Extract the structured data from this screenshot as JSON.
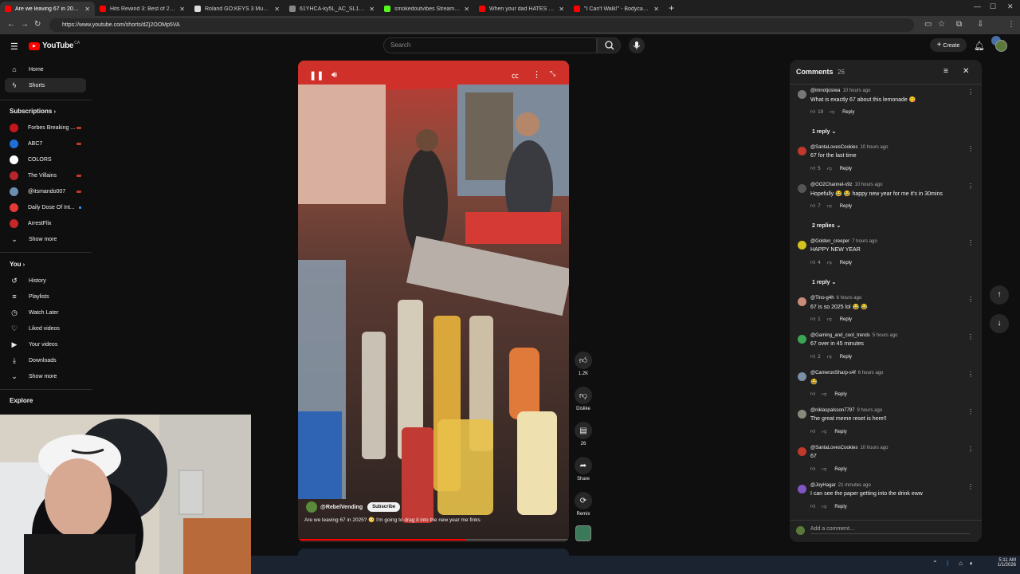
{
  "browser": {
    "tabs": [
      {
        "title": "Are we leaving 67 in 2025?",
        "color": "#ff0000",
        "active": true
      },
      {
        "title": "Hits Rewind 3: Best of 2010's H",
        "color": "#ff0000"
      },
      {
        "title": "Roland GO:KEYS 3 Music Creati",
        "color": "#dddddd"
      },
      {
        "title": "61YHCA-ky5L_AC_SL1500_.jpg",
        "color": "#888888"
      },
      {
        "title": "smokedoutvibes Stream - Watc",
        "color": "#53fc18"
      },
      {
        "title": "When your dad HATES cats",
        "color": "#ff0000"
      },
      {
        "title": "\"I Can't Walk!\" - Bodycam Prov",
        "color": "#ff0000"
      }
    ],
    "new_tab": "+",
    "url": "https://www.youtube.com/shorts/dZj2OOMp5VA"
  },
  "header": {
    "logo": "YouTube",
    "country": "CA",
    "search_placeholder": "Search",
    "create_label": "Create"
  },
  "sidebar": {
    "main": [
      {
        "label": "Home",
        "icon": "home-icon"
      },
      {
        "label": "Shorts",
        "icon": "shorts-icon",
        "active": true
      }
    ],
    "subscriptions_title": "Subscriptions",
    "subscriptions": [
      {
        "label": "Forbes Breaking ...",
        "color": "#c4161c",
        "live": true
      },
      {
        "label": "ABC7",
        "color": "#1e6fd9",
        "live": true
      },
      {
        "label": "COLORS",
        "color": "#ffffff",
        "live": false
      },
      {
        "label": "The Villains",
        "color": "#b8262b",
        "live": true
      },
      {
        "label": "@itsmando007",
        "color": "#6b8fb3",
        "live": true
      },
      {
        "label": "Daily Dose Of Int...",
        "color": "#e53935",
        "live": false,
        "dot": true
      },
      {
        "label": "ArrestFlix",
        "color": "#c62828",
        "live": false
      }
    ],
    "subs_show_more": "Show more",
    "you_title": "You",
    "you_items": [
      {
        "label": "History",
        "icon": "history-icon"
      },
      {
        "label": "Playlists",
        "icon": "playlists-icon"
      },
      {
        "label": "Watch Later",
        "icon": "watch-later-icon"
      },
      {
        "label": "Liked videos",
        "icon": "liked-icon"
      },
      {
        "label": "Your videos",
        "icon": "your-videos-icon"
      },
      {
        "label": "Downloads",
        "icon": "downloads-icon"
      }
    ],
    "you_show_more": "Show more",
    "explore_title": "Explore"
  },
  "short": {
    "channel": "@RebelVending",
    "subscribe_label": "Subscribe",
    "caption": "Are we leaving 67 in 2025? 😳 I'm going to drag it into the new year me finks"
  },
  "actions": {
    "likes": "1.2K",
    "dislike_label": "Dislike",
    "comments_count": "26",
    "share_label": "Share",
    "remix_label": "Remix"
  },
  "comments": {
    "title": "Comments",
    "count": "26",
    "add_placeholder": "Add a comment...",
    "reply_label": "Reply",
    "items": [
      {
        "user": "@imnotjosiwa",
        "ago": "10 hours ago",
        "text": "What is exactly 67 about this lemonade 😋",
        "likes": "19",
        "color": "#777777",
        "replies": "1 reply"
      },
      {
        "user": "@SantaLovesCookies",
        "ago": "10 hours ago",
        "text": "67 for the last time",
        "likes": "5",
        "color": "#c0392b"
      },
      {
        "user": "@GO2Channel-s9z",
        "ago": "10 hours ago",
        "text": "Hopefully 😂 😂 happy new year for me it's in 30mins",
        "likes": "7",
        "color": "#555555",
        "replies": "2 replies"
      },
      {
        "user": "@Golden_creeper",
        "ago": "7 hours ago",
        "text": "HAPPY NEW YEAR",
        "likes": "4",
        "color": "#d4c21e",
        "replies": "1 reply"
      },
      {
        "user": "@Tino-g4h",
        "ago": "6 hours ago",
        "text": "67 is so 2025 lol 😂 😂",
        "likes": "1",
        "color": "#c98b7a"
      },
      {
        "user": "@Gaming_and_cool_trends",
        "ago": "5 hours ago",
        "text": "67 over in 45 minutes",
        "likes": "2",
        "color": "#3aa655"
      },
      {
        "user": "@CameronSharp-s4f",
        "ago": "6 hours ago",
        "text": "😂",
        "likes": "",
        "color": "#7b8fa6"
      },
      {
        "user": "@niklaspalsson7797",
        "ago": "9 hours ago",
        "text": "The great meme reset is here!!",
        "likes": "",
        "color": "#8a8a7a"
      },
      {
        "user": "@SantaLovesCookies",
        "ago": "10 hours ago",
        "text": "67",
        "likes": "",
        "color": "#c0392b"
      },
      {
        "user": "@JoyHagar",
        "ago": "21 minutes ago",
        "text": "I can see the paper getting into the drink eww",
        "likes": "",
        "color": "#7e57c2"
      }
    ]
  },
  "taskbar": {
    "time": "5:11 AM",
    "date": "1/1/2026"
  }
}
